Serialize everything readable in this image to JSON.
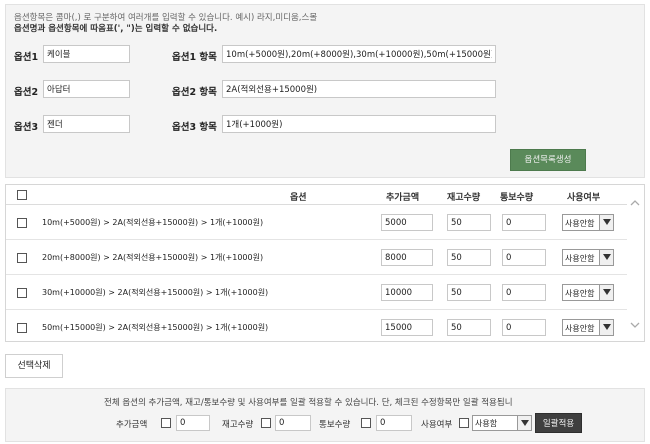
{
  "notice": {
    "line1": "옵션항목은 콤마(,) 로 구분하여 여러개를 입력할 수 있습니다. 예시) 라지,미디움,스몰",
    "line2": "옵션명과 옵션항목에 따옴표(', \")는 입력할 수 없습니다."
  },
  "options": [
    {
      "name_label": "옵션1",
      "name_value": "케이블",
      "items_label": "옵션1 항목",
      "items_value": "10m(+5000원),20m(+8000원),30m(+10000원),50m(+15000원)"
    },
    {
      "name_label": "옵션2",
      "name_value": "아답터",
      "items_label": "옵션2 항목",
      "items_value": "2A(적외선용+15000원)"
    },
    {
      "name_label": "옵션3",
      "name_value": "젠더",
      "items_label": "옵션3 항목",
      "items_value": "1개(+1000원)"
    }
  ],
  "generate_button": "옵션목록생성",
  "list": {
    "headers": {
      "option": "옵션",
      "extra_price": "추가금액",
      "stock": "재고수량",
      "notify": "통보수량",
      "usage": "사용여부"
    },
    "rows": [
      {
        "label": "10m(+5000원) > 2A(적외선용+15000원) > 1개(+1000원)",
        "extra_price": "5000",
        "stock": "50",
        "notify": "0",
        "usage": "사용안함"
      },
      {
        "label": "20m(+8000원) > 2A(적외선용+15000원) > 1개(+1000원)",
        "extra_price": "8000",
        "stock": "50",
        "notify": "0",
        "usage": "사용안함"
      },
      {
        "label": "30m(+10000원) > 2A(적외선용+15000원) > 1개(+1000원)",
        "extra_price": "10000",
        "stock": "50",
        "notify": "0",
        "usage": "사용안함"
      },
      {
        "label": "50m(+15000원) > 2A(적외선용+15000원) > 1개(+1000원)",
        "extra_price": "15000",
        "stock": "50",
        "notify": "0",
        "usage": "사용안함"
      }
    ]
  },
  "delete_button": "선택삭제",
  "bulk": {
    "note": "전체 옵션의 추가금액, 재고/통보수량 및 사용여부를 일괄 적용할 수 있습니다. 단, 체크된 수정항목만 일괄 적용됩니",
    "extra_price_label": "추가금액",
    "extra_price_value": "0",
    "stock_label": "재고수량",
    "stock_value": "0",
    "notify_label": "통보수량",
    "notify_value": "0",
    "usage_label": "사용여부",
    "usage_value": "사용함",
    "apply_button": "일괄적용"
  },
  "icons": {
    "select_arrow": "chevron-down-icon",
    "scroll_up": "chevron-up-icon",
    "scroll_down": "chevron-down-icon"
  }
}
